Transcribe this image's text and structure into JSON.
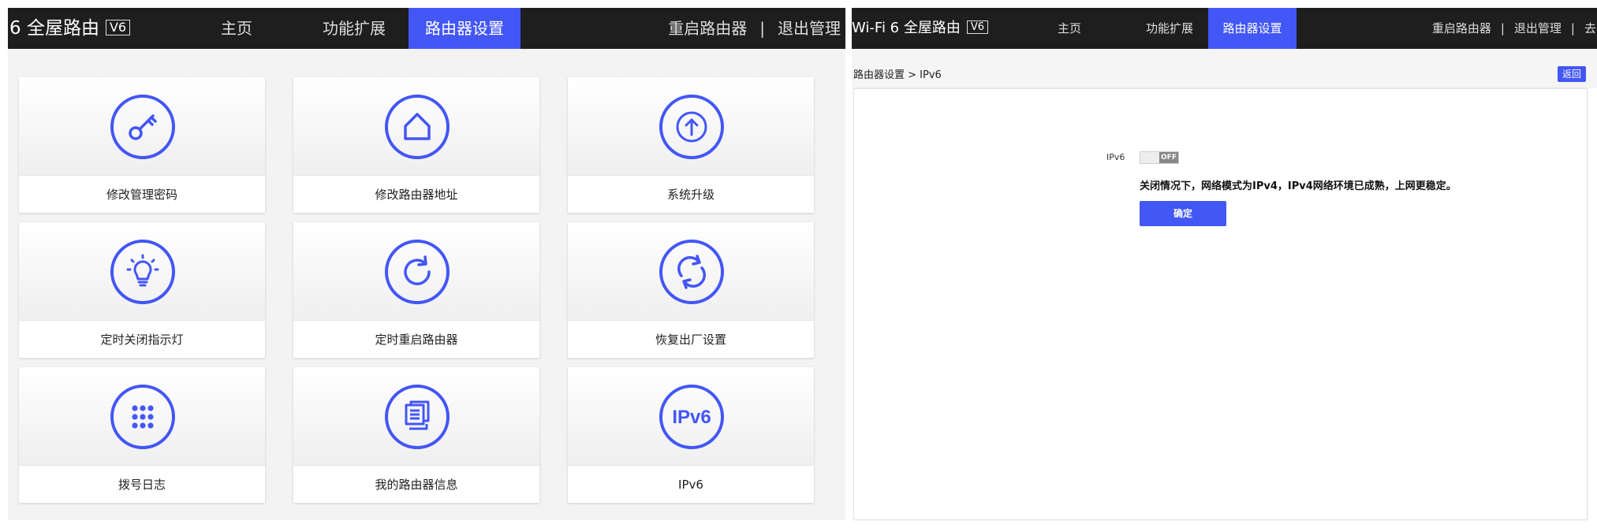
{
  "left": {
    "brand": {
      "title": "6 全屋路由",
      "version": "V6"
    },
    "nav": [
      {
        "label": "主页"
      },
      {
        "label": "功能扩展"
      },
      {
        "label": "路由器设置"
      }
    ],
    "nav_right": {
      "restart": "重启路由器",
      "sep": "|",
      "logout": "退出管理"
    },
    "cards": [
      {
        "label": "修改管理密码",
        "icon": "key-icon"
      },
      {
        "label": "修改路由器地址",
        "icon": "home-icon"
      },
      {
        "label": "系统升级",
        "icon": "upgrade-arrow-icon"
      },
      {
        "label": "定时关闭指示灯",
        "icon": "lightbulb-icon"
      },
      {
        "label": "定时重启路由器",
        "icon": "refresh-icon"
      },
      {
        "label": "恢复出厂设置",
        "icon": "restore-cycle-icon"
      },
      {
        "label": "拨号日志",
        "icon": "dial-grid-icon"
      },
      {
        "label": "我的路由器信息",
        "icon": "documents-icon"
      },
      {
        "label": "IPv6",
        "icon": "ipv6-icon",
        "icon_text": "IPv6"
      }
    ]
  },
  "right": {
    "brand": {
      "title": "Wi-Fi 6 全屋路由",
      "version": "V6"
    },
    "nav": [
      {
        "label": "主页"
      },
      {
        "label": "功能扩展"
      },
      {
        "label": "路由器设置"
      }
    ],
    "nav_right": {
      "restart": "重启路由器",
      "sep1": "|",
      "logout": "退出管理",
      "sep2": "|",
      "more": "去官"
    },
    "breadcrumb": "路由器设置 > IPv6",
    "back_label": "返回",
    "ipv6_label": "IPv6",
    "toggle_state": "OFF",
    "note": "关闭情况下，网络模式为IPv4，IPv4网络环境已成熟，上网更稳定。",
    "confirm_label": "确定"
  },
  "colors": {
    "accent": "#4356f6",
    "navbar": "#1e1e1e"
  }
}
